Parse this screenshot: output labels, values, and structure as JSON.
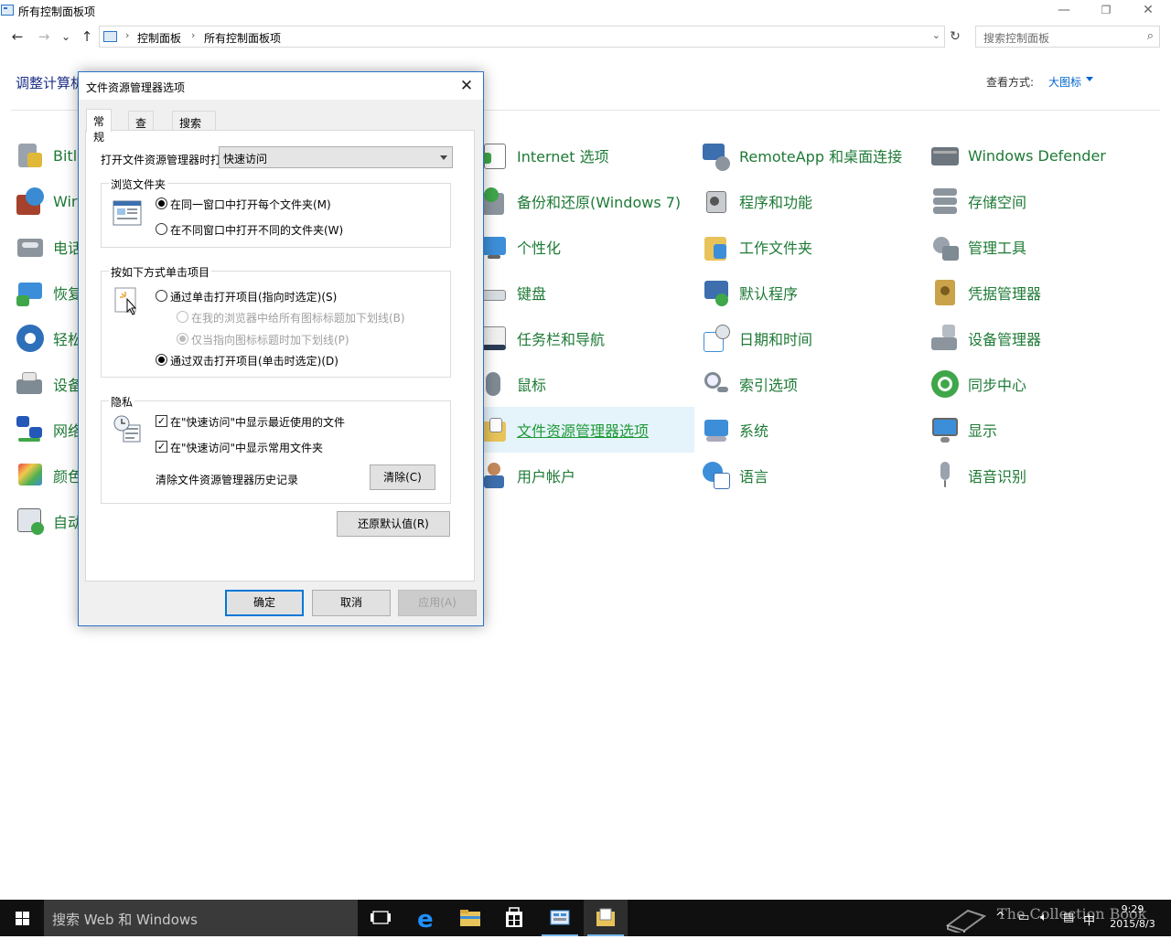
{
  "window": {
    "title": "所有控制面板项",
    "minimize": "—",
    "maximize": "❐",
    "close": "✕"
  },
  "address": {
    "back": "←",
    "forward": "→",
    "recent": "⌄",
    "up": "↑",
    "crumbs": [
      "控制面板",
      "所有控制面板项"
    ],
    "sep": "›",
    "refresh": "↻",
    "dropdown": "⌄",
    "search_placeholder": "搜索控制面板",
    "search_icon": "⌕"
  },
  "page": {
    "heading": "调整计算机",
    "view_by_label": "查看方式:",
    "view_by_value": "大图标"
  },
  "items": [
    {
      "label": "Bitl",
      "icon": "bitlocker-icon"
    },
    {
      "label": "Wir",
      "icon": "firewall-icon"
    },
    {
      "label": "电话",
      "icon": "phone-modem-icon"
    },
    {
      "label": "恢复",
      "icon": "recovery-icon"
    },
    {
      "label": "轻松",
      "icon": "ease-of-access-icon"
    },
    {
      "label": "设备",
      "icon": "devices-printers-icon"
    },
    {
      "label": "网络",
      "icon": "network-icon"
    },
    {
      "label": "颜色",
      "icon": "color-management-icon"
    },
    {
      "label": "自动",
      "icon": "autoplay-icon"
    },
    {
      "label": "Internet 选项",
      "icon": "internet-options-icon"
    },
    {
      "label": "备份和还原(Windows 7)",
      "icon": "backup-restore-icon"
    },
    {
      "label": "个性化",
      "icon": "personalization-icon"
    },
    {
      "label": "键盘",
      "icon": "keyboard-icon"
    },
    {
      "label": "任务栏和导航",
      "icon": "taskbar-icon"
    },
    {
      "label": "鼠标",
      "icon": "mouse-icon"
    },
    {
      "label": "文件资源管理器选项",
      "icon": "folder-options-icon"
    },
    {
      "label": "用户帐户",
      "icon": "user-accounts-icon"
    },
    {
      "label": "RemoteApp 和桌面连接",
      "icon": "remoteapp-icon"
    },
    {
      "label": "程序和功能",
      "icon": "programs-features-icon"
    },
    {
      "label": "工作文件夹",
      "icon": "work-folders-icon"
    },
    {
      "label": "默认程序",
      "icon": "default-programs-icon"
    },
    {
      "label": "日期和时间",
      "icon": "date-time-icon"
    },
    {
      "label": "索引选项",
      "icon": "indexing-options-icon"
    },
    {
      "label": "系统",
      "icon": "system-icon"
    },
    {
      "label": "语言",
      "icon": "language-icon"
    },
    {
      "label": "Windows Defender",
      "icon": "defender-icon"
    },
    {
      "label": "存储空间",
      "icon": "storage-spaces-icon"
    },
    {
      "label": "管理工具",
      "icon": "admin-tools-icon"
    },
    {
      "label": "凭据管理器",
      "icon": "credential-manager-icon"
    },
    {
      "label": "设备管理器",
      "icon": "device-manager-icon"
    },
    {
      "label": "同步中心",
      "icon": "sync-center-icon"
    },
    {
      "label": "显示",
      "icon": "display-icon"
    },
    {
      "label": "语音识别",
      "icon": "speech-recognition-icon"
    }
  ],
  "dialog": {
    "title": "文件资源管理器选项",
    "close": "✕",
    "tabs": [
      "常规",
      "查看",
      "搜索"
    ],
    "open_in_label": "打开文件资源管理器时打",
    "open_in_value": "快速访问",
    "browse_group": {
      "title": "浏览文件夹",
      "options": [
        "在同一窗口中打开每个文件夹(M)",
        "在不同窗口中打开不同的文件夹(W)"
      ]
    },
    "click_group": {
      "title": "按如下方式单击项目",
      "options": [
        "通过单击打开项目(指向时选定)(S)",
        "在我的浏览器中给所有图标标题加下划线(B)",
        "仅当指向图标标题时加下划线(P)",
        "通过双击打开项目(单击时选定)(D)"
      ]
    },
    "privacy_group": {
      "title": "隐私",
      "options": [
        "在\"快速访问\"中显示最近使用的文件",
        "在\"快速访问\"中显示常用文件夹"
      ],
      "clear_label": "清除文件资源管理器历史记录",
      "clear_button": "清除(C)"
    },
    "restore_button": "还原默认值(R)",
    "ok": "确定",
    "cancel": "取消",
    "apply": "应用(A)"
  },
  "taskbar": {
    "search_placeholder": "搜索 Web 和 Windows",
    "time": "9:29",
    "date": "2015/8/3",
    "ime": "中",
    "watermark": "The Collection Book",
    "tray_arrow": "^"
  }
}
